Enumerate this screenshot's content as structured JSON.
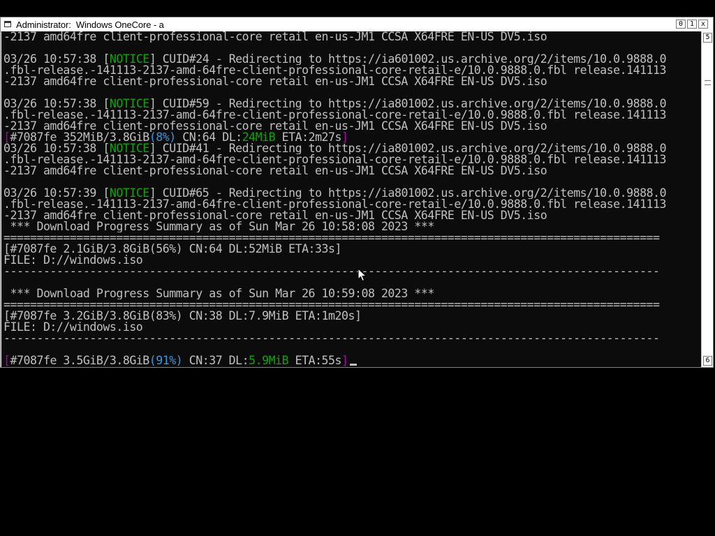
{
  "window": {
    "title": "Administrator:  Windows OneCore - a",
    "buttons": {
      "minimize": "0",
      "maximize": "1",
      "close": "x"
    },
    "scroll": {
      "up_label": "5",
      "down_label": "6"
    }
  },
  "console": {
    "lines": [
      [
        {
          "t": "-2137_amd64fre_client-professional-core_retail_en-us-JM1_CCSA_X64FRE_EN-US_DV5.iso"
        }
      ],
      [
        {
          "t": ""
        }
      ],
      [
        {
          "t": "03/26 10:57:38 ["
        },
        {
          "t": "NOTICE",
          "c": "green"
        },
        {
          "t": "] CUID#24 - Redirecting to https://ia601002.us.archive.org/2/items/10.0.9888.0"
        }
      ],
      [
        {
          "t": ".fbl-release.-141113-2137-amd-64fre-client-professional-core-retail-e/10.0.9888.0.fbl_release.141113"
        }
      ],
      [
        {
          "t": "-2137_amd64fre_client-professional-core_retail_en-us-JM1_CCSA_X64FRE_EN-US_DV5.iso"
        }
      ],
      [
        {
          "t": ""
        }
      ],
      [
        {
          "t": "03/26 10:57:38 ["
        },
        {
          "t": "NOTICE",
          "c": "green"
        },
        {
          "t": "] CUID#59 - Redirecting to https://ia801002.us.archive.org/2/items/10.0.9888.0"
        }
      ],
      [
        {
          "t": ".fbl-release.-141113-2137-amd-64fre-client-professional-core-retail-e/10.0.9888.0.fbl_release.141113"
        }
      ],
      [
        {
          "t": "-2137_amd64fre_client-professional-core_retail_en-us-JM1_CCSA_X64FRE_EN-US_DV5.iso"
        }
      ],
      [
        {
          "t": "[",
          "c": "magenta"
        },
        {
          "t": "#7087fe 352MiB/3.8GiB"
        },
        {
          "t": "(8%)",
          "c": "cyan"
        },
        {
          "t": " CN:64 DL:"
        },
        {
          "t": "24MiB",
          "c": "green"
        },
        {
          "t": " ETA:2m27s"
        },
        {
          "t": "]",
          "c": "magenta"
        }
      ],
      [
        {
          "t": "03/26 10:57:38 ["
        },
        {
          "t": "NOTICE",
          "c": "green"
        },
        {
          "t": "] CUID#41 - Redirecting to https://ia801002.us.archive.org/2/items/10.0.9888.0"
        }
      ],
      [
        {
          "t": ".fbl-release.-141113-2137-amd-64fre-client-professional-core-retail-e/10.0.9888.0.fbl_release.141113"
        }
      ],
      [
        {
          "t": "-2137_amd64fre_client-professional-core_retail_en-us-JM1_CCSA_X64FRE_EN-US_DV5.iso"
        }
      ],
      [
        {
          "t": ""
        }
      ],
      [
        {
          "t": "03/26 10:57:39 ["
        },
        {
          "t": "NOTICE",
          "c": "green"
        },
        {
          "t": "] CUID#65 - Redirecting to https://ia801002.us.archive.org/2/items/10.0.9888.0"
        }
      ],
      [
        {
          "t": ".fbl-release.-141113-2137-amd-64fre-client-professional-core-retail-e/10.0.9888.0.fbl_release.141113"
        }
      ],
      [
        {
          "t": "-2137_amd64fre_client-professional-core_retail_en-us-JM1_CCSA_X64FRE_EN-US_DV5.iso"
        }
      ],
      [
        {
          "t": " *** Download Progress Summary as of Sun Mar 26 10:58:08 2023 ***"
        }
      ],
      [
        {
          "t": "==================================================================================================="
        }
      ],
      [
        {
          "t": "[#7087fe 2.1GiB/3.8GiB(56%) CN:64 DL:52MiB ETA:33s]"
        }
      ],
      [
        {
          "t": "FILE: D://windows.iso"
        }
      ],
      [
        {
          "t": "---------------------------------------------------------------------------------------------------"
        }
      ],
      [
        {
          "t": ""
        }
      ],
      [
        {
          "t": " *** Download Progress Summary as of Sun Mar 26 10:59:08 2023 ***"
        }
      ],
      [
        {
          "t": "==================================================================================================="
        }
      ],
      [
        {
          "t": "[#7087fe 3.2GiB/3.8GiB(83%) CN:38 DL:7.9MiB ETA:1m20s]"
        }
      ],
      [
        {
          "t": "FILE: D://windows.iso"
        }
      ],
      [
        {
          "t": "---------------------------------------------------------------------------------------------------"
        }
      ],
      [
        {
          "t": ""
        }
      ],
      [
        {
          "t": "[",
          "c": "magenta"
        },
        {
          "t": "#7087fe 3.5GiB/3.8GiB"
        },
        {
          "t": "(91%)",
          "c": "cyan"
        },
        {
          "t": " CN:37 DL:"
        },
        {
          "t": "5.9MiB",
          "c": "green"
        },
        {
          "t": " ETA:55s"
        },
        {
          "t": "]",
          "c": "magenta"
        }
      ]
    ]
  },
  "colors": {
    "green": "#13a10e",
    "magenta": "#b000b0",
    "cyan": "#3a96dd",
    "text": "#c0c0c0",
    "background": "#0c0c0c"
  },
  "cursor": {
    "icon": "mouse-pointer-icon"
  }
}
